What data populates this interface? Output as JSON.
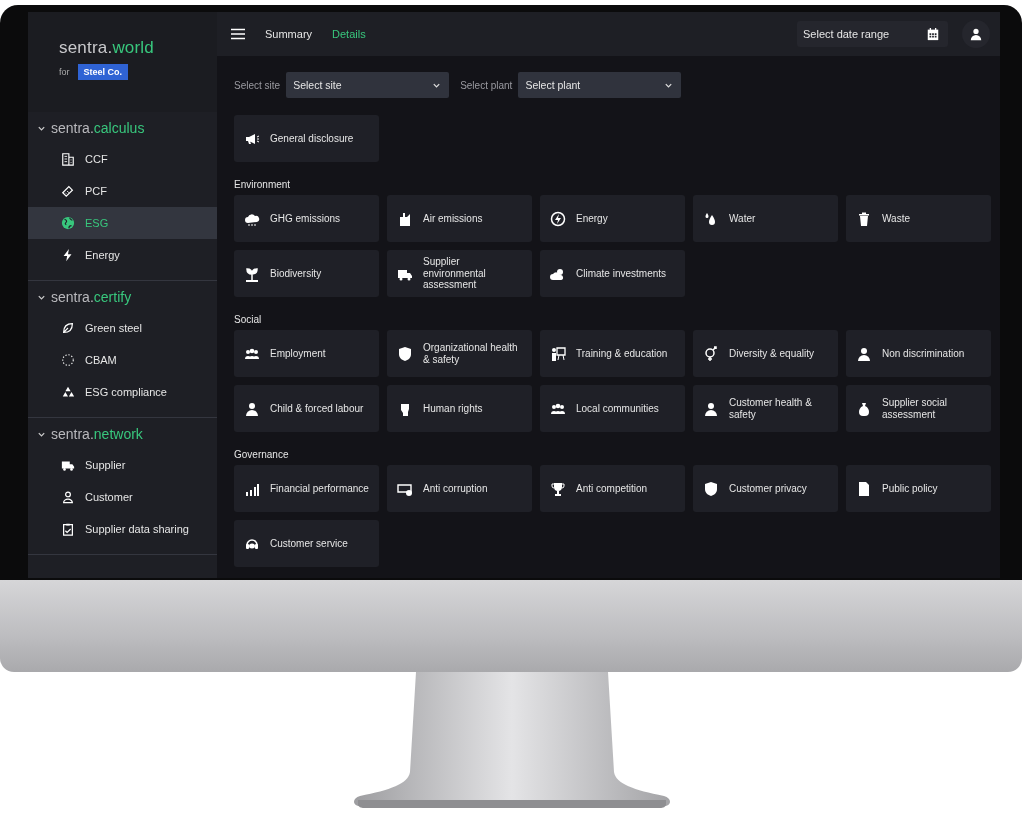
{
  "brand": {
    "prefix": "sentra.",
    "suffix": "world",
    "for_label": "for",
    "company": "Steel Co."
  },
  "sidebar": {
    "sections": [
      {
        "prefix": "sentra.",
        "suffix": "calculus",
        "expanded": true,
        "items": [
          {
            "label": "CCF",
            "selected": false
          },
          {
            "label": "PCF",
            "selected": false
          },
          {
            "label": "ESG",
            "selected": true
          },
          {
            "label": "Energy",
            "selected": false
          }
        ]
      },
      {
        "prefix": "sentra.",
        "suffix": "certify",
        "expanded": true,
        "items": [
          {
            "label": "Green steel",
            "selected": false
          },
          {
            "label": "CBAM",
            "selected": false
          },
          {
            "label": "ESG compliance",
            "selected": false
          }
        ]
      },
      {
        "prefix": "sentra.",
        "suffix": "network",
        "expanded": true,
        "items": [
          {
            "label": "Supplier",
            "selected": false
          },
          {
            "label": "Customer",
            "selected": false
          },
          {
            "label": "Supplier data sharing",
            "selected": false
          }
        ]
      }
    ]
  },
  "tabs": [
    {
      "label": "Summary",
      "selected": false
    },
    {
      "label": "Details",
      "selected": true
    }
  ],
  "date_range": {
    "placeholder": "Select date range"
  },
  "filters": [
    {
      "label": "Select site",
      "placeholder": "Select site"
    },
    {
      "label": "Select plant",
      "placeholder": "Select plant"
    }
  ],
  "general": [
    {
      "label": "General disclosure"
    }
  ],
  "groups": [
    {
      "title": "Environment",
      "cards": [
        {
          "label": "GHG emissions"
        },
        {
          "label": "Air emissions"
        },
        {
          "label": "Energy"
        },
        {
          "label": "Water"
        },
        {
          "label": "Waste"
        },
        {
          "label": "Biodiversity"
        },
        {
          "label": "Supplier environmental assessment"
        },
        {
          "label": "Climate investments"
        }
      ]
    },
    {
      "title": "Social",
      "cards": [
        {
          "label": "Employment"
        },
        {
          "label": "Organizational health & safety"
        },
        {
          "label": "Training & education"
        },
        {
          "label": "Diversity & equality"
        },
        {
          "label": "Non discrimination"
        },
        {
          "label": "Child & forced labour"
        },
        {
          "label": "Human rights"
        },
        {
          "label": "Local communities"
        },
        {
          "label": "Customer health & safety"
        },
        {
          "label": "Supplier social assessment"
        }
      ]
    },
    {
      "title": "Governance",
      "cards": [
        {
          "label": "Financial performance"
        },
        {
          "label": "Anti corruption"
        },
        {
          "label": "Anti competition"
        },
        {
          "label": "Customer privacy"
        },
        {
          "label": "Public policy"
        },
        {
          "label": "Customer service"
        }
      ]
    }
  ]
}
